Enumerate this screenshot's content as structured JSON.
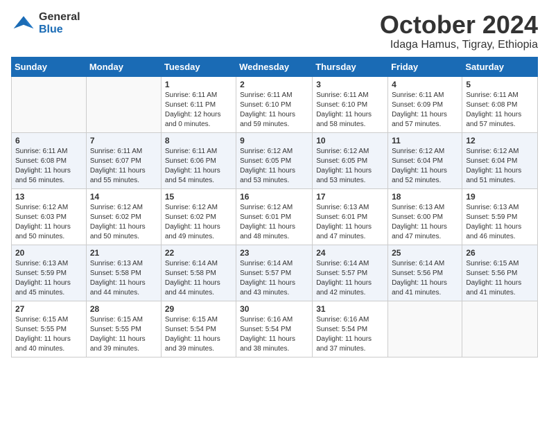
{
  "logo": {
    "line1": "General",
    "line2": "Blue"
  },
  "title": "October 2024",
  "subtitle": "Idaga Hamus, Tigray, Ethiopia",
  "header_days": [
    "Sunday",
    "Monday",
    "Tuesday",
    "Wednesday",
    "Thursday",
    "Friday",
    "Saturday"
  ],
  "weeks": [
    [
      {
        "day": "",
        "info": ""
      },
      {
        "day": "",
        "info": ""
      },
      {
        "day": "1",
        "sunrise": "Sunrise: 6:11 AM",
        "sunset": "Sunset: 6:11 PM",
        "daylight": "Daylight: 12 hours and 0 minutes."
      },
      {
        "day": "2",
        "sunrise": "Sunrise: 6:11 AM",
        "sunset": "Sunset: 6:10 PM",
        "daylight": "Daylight: 11 hours and 59 minutes."
      },
      {
        "day": "3",
        "sunrise": "Sunrise: 6:11 AM",
        "sunset": "Sunset: 6:10 PM",
        "daylight": "Daylight: 11 hours and 58 minutes."
      },
      {
        "day": "4",
        "sunrise": "Sunrise: 6:11 AM",
        "sunset": "Sunset: 6:09 PM",
        "daylight": "Daylight: 11 hours and 57 minutes."
      },
      {
        "day": "5",
        "sunrise": "Sunrise: 6:11 AM",
        "sunset": "Sunset: 6:08 PM",
        "daylight": "Daylight: 11 hours and 57 minutes."
      }
    ],
    [
      {
        "day": "6",
        "sunrise": "Sunrise: 6:11 AM",
        "sunset": "Sunset: 6:08 PM",
        "daylight": "Daylight: 11 hours and 56 minutes."
      },
      {
        "day": "7",
        "sunrise": "Sunrise: 6:11 AM",
        "sunset": "Sunset: 6:07 PM",
        "daylight": "Daylight: 11 hours and 55 minutes."
      },
      {
        "day": "8",
        "sunrise": "Sunrise: 6:11 AM",
        "sunset": "Sunset: 6:06 PM",
        "daylight": "Daylight: 11 hours and 54 minutes."
      },
      {
        "day": "9",
        "sunrise": "Sunrise: 6:12 AM",
        "sunset": "Sunset: 6:05 PM",
        "daylight": "Daylight: 11 hours and 53 minutes."
      },
      {
        "day": "10",
        "sunrise": "Sunrise: 6:12 AM",
        "sunset": "Sunset: 6:05 PM",
        "daylight": "Daylight: 11 hours and 53 minutes."
      },
      {
        "day": "11",
        "sunrise": "Sunrise: 6:12 AM",
        "sunset": "Sunset: 6:04 PM",
        "daylight": "Daylight: 11 hours and 52 minutes."
      },
      {
        "day": "12",
        "sunrise": "Sunrise: 6:12 AM",
        "sunset": "Sunset: 6:04 PM",
        "daylight": "Daylight: 11 hours and 51 minutes."
      }
    ],
    [
      {
        "day": "13",
        "sunrise": "Sunrise: 6:12 AM",
        "sunset": "Sunset: 6:03 PM",
        "daylight": "Daylight: 11 hours and 50 minutes."
      },
      {
        "day": "14",
        "sunrise": "Sunrise: 6:12 AM",
        "sunset": "Sunset: 6:02 PM",
        "daylight": "Daylight: 11 hours and 50 minutes."
      },
      {
        "day": "15",
        "sunrise": "Sunrise: 6:12 AM",
        "sunset": "Sunset: 6:02 PM",
        "daylight": "Daylight: 11 hours and 49 minutes."
      },
      {
        "day": "16",
        "sunrise": "Sunrise: 6:12 AM",
        "sunset": "Sunset: 6:01 PM",
        "daylight": "Daylight: 11 hours and 48 minutes."
      },
      {
        "day": "17",
        "sunrise": "Sunrise: 6:13 AM",
        "sunset": "Sunset: 6:01 PM",
        "daylight": "Daylight: 11 hours and 47 minutes."
      },
      {
        "day": "18",
        "sunrise": "Sunrise: 6:13 AM",
        "sunset": "Sunset: 6:00 PM",
        "daylight": "Daylight: 11 hours and 47 minutes."
      },
      {
        "day": "19",
        "sunrise": "Sunrise: 6:13 AM",
        "sunset": "Sunset: 5:59 PM",
        "daylight": "Daylight: 11 hours and 46 minutes."
      }
    ],
    [
      {
        "day": "20",
        "sunrise": "Sunrise: 6:13 AM",
        "sunset": "Sunset: 5:59 PM",
        "daylight": "Daylight: 11 hours and 45 minutes."
      },
      {
        "day": "21",
        "sunrise": "Sunrise: 6:13 AM",
        "sunset": "Sunset: 5:58 PM",
        "daylight": "Daylight: 11 hours and 44 minutes."
      },
      {
        "day": "22",
        "sunrise": "Sunrise: 6:14 AM",
        "sunset": "Sunset: 5:58 PM",
        "daylight": "Daylight: 11 hours and 44 minutes."
      },
      {
        "day": "23",
        "sunrise": "Sunrise: 6:14 AM",
        "sunset": "Sunset: 5:57 PM",
        "daylight": "Daylight: 11 hours and 43 minutes."
      },
      {
        "day": "24",
        "sunrise": "Sunrise: 6:14 AM",
        "sunset": "Sunset: 5:57 PM",
        "daylight": "Daylight: 11 hours and 42 minutes."
      },
      {
        "day": "25",
        "sunrise": "Sunrise: 6:14 AM",
        "sunset": "Sunset: 5:56 PM",
        "daylight": "Daylight: 11 hours and 41 minutes."
      },
      {
        "day": "26",
        "sunrise": "Sunrise: 6:15 AM",
        "sunset": "Sunset: 5:56 PM",
        "daylight": "Daylight: 11 hours and 41 minutes."
      }
    ],
    [
      {
        "day": "27",
        "sunrise": "Sunrise: 6:15 AM",
        "sunset": "Sunset: 5:55 PM",
        "daylight": "Daylight: 11 hours and 40 minutes."
      },
      {
        "day": "28",
        "sunrise": "Sunrise: 6:15 AM",
        "sunset": "Sunset: 5:55 PM",
        "daylight": "Daylight: 11 hours and 39 minutes."
      },
      {
        "day": "29",
        "sunrise": "Sunrise: 6:15 AM",
        "sunset": "Sunset: 5:54 PM",
        "daylight": "Daylight: 11 hours and 39 minutes."
      },
      {
        "day": "30",
        "sunrise": "Sunrise: 6:16 AM",
        "sunset": "Sunset: 5:54 PM",
        "daylight": "Daylight: 11 hours and 38 minutes."
      },
      {
        "day": "31",
        "sunrise": "Sunrise: 6:16 AM",
        "sunset": "Sunset: 5:54 PM",
        "daylight": "Daylight: 11 hours and 37 minutes."
      },
      {
        "day": "",
        "info": ""
      },
      {
        "day": "",
        "info": ""
      }
    ]
  ]
}
